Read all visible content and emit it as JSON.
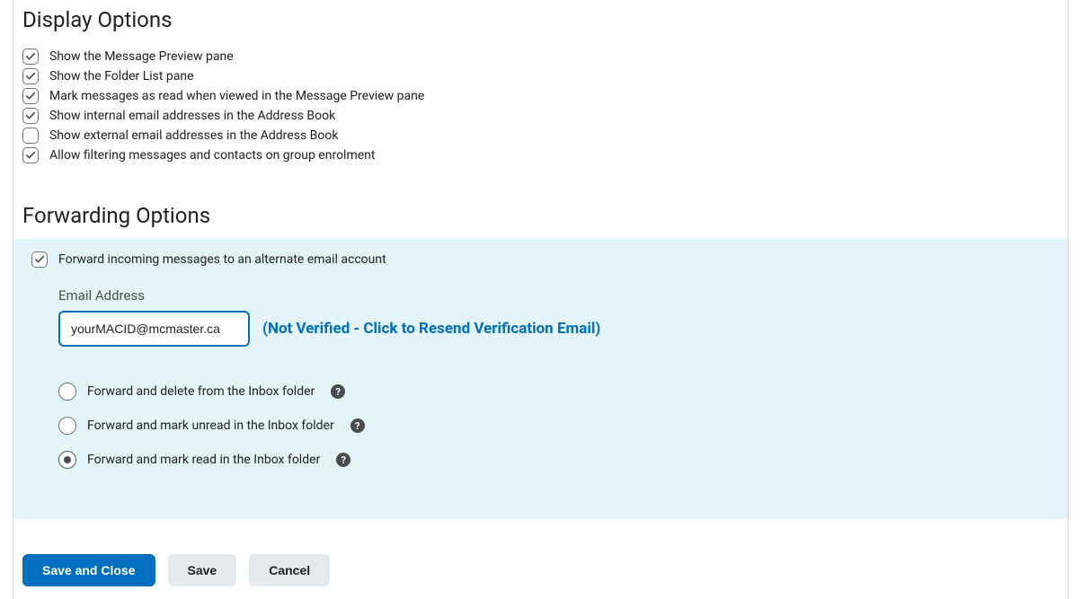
{
  "displayOptions": {
    "heading": "Display Options",
    "items": [
      {
        "label": "Show the Message Preview pane",
        "checked": true
      },
      {
        "label": "Show the Folder List pane",
        "checked": true
      },
      {
        "label": "Mark messages as read when viewed in the Message Preview pane",
        "checked": true
      },
      {
        "label": "Show internal email addresses in the Address Book",
        "checked": true
      },
      {
        "label": "Show external email addresses in the Address Book",
        "checked": false
      },
      {
        "label": "Allow filtering messages and contacts on group enrolment",
        "checked": true
      }
    ]
  },
  "forwardingOptions": {
    "heading": "Forwarding Options",
    "forwardCheckbox": {
      "label": "Forward incoming messages to an alternate email account",
      "checked": true
    },
    "emailField": {
      "label": "Email Address",
      "value": "yourMACID@mcmaster.ca"
    },
    "verificationText": "(Not Verified - Click to Resend Verification Email)",
    "radioOptions": [
      {
        "label": "Forward and delete from the Inbox folder",
        "selected": false
      },
      {
        "label": "Forward and mark unread in the Inbox folder",
        "selected": false
      },
      {
        "label": "Forward and mark read in the Inbox folder",
        "selected": true
      }
    ]
  },
  "buttons": {
    "saveAndClose": "Save and Close",
    "save": "Save",
    "cancel": "Cancel"
  }
}
